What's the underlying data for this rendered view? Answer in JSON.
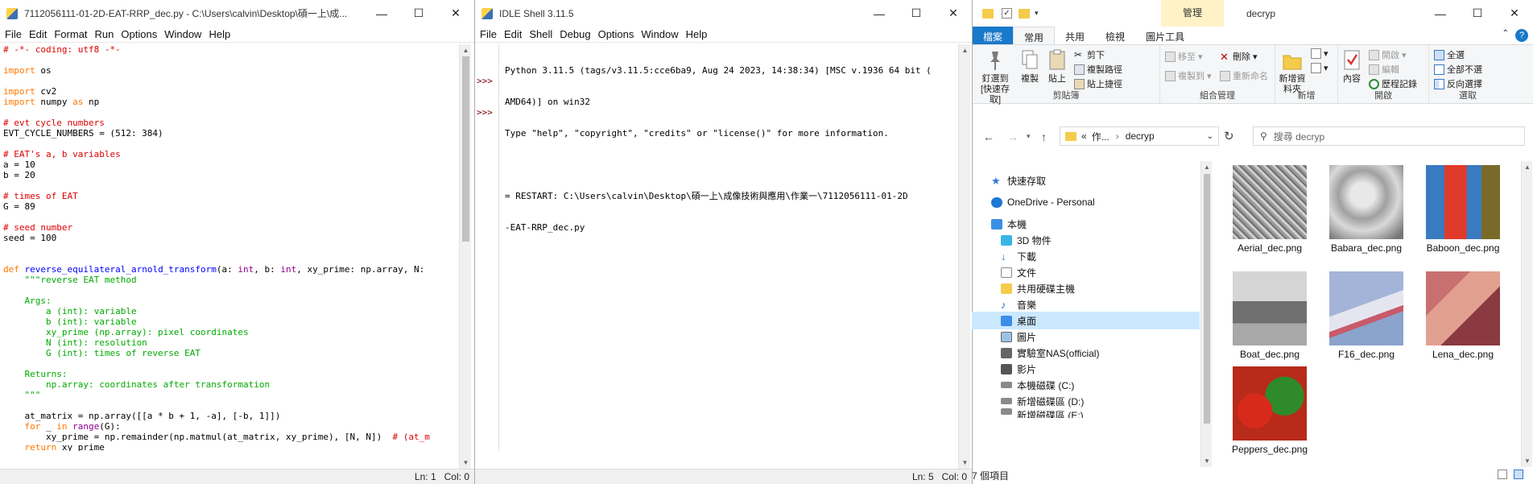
{
  "editor": {
    "title": "7112056111-01-2D-EAT-RRP_dec.py - C:\\Users\\calvin\\Desktop\\碩一上\\成...",
    "menus": [
      "File",
      "Edit",
      "Format",
      "Run",
      "Options",
      "Window",
      "Help"
    ],
    "status_ln": "Ln: 1",
    "status_col": "Col: 0"
  },
  "shell": {
    "title": "IDLE Shell 3.11.5",
    "menus": [
      "File",
      "Edit",
      "Shell",
      "Debug",
      "Options",
      "Window",
      "Help"
    ],
    "prompt": ">>>",
    "lines": [
      "Python 3.11.5 (tags/v3.11.5:cce6ba9, Aug 24 2023, 14:38:34) [MSC v.1936 64 bit (",
      "AMD64)] on win32",
      "Type \"help\", \"copyright\", \"credits\" or \"license()\" for more information.",
      "",
      "= RESTART: C:\\Users\\calvin\\Desktop\\碩一上\\成像技術與應用\\作業一\\7112056111-01-2D",
      "-EAT-RRP_dec.py"
    ],
    "status_ln": "Ln: 5",
    "status_col": "Col: 0"
  },
  "explorer": {
    "title": "decryp",
    "tool_tab": "管理",
    "tabs": [
      "檔案",
      "常用",
      "共用",
      "檢視",
      "圖片工具"
    ],
    "ribbon": {
      "pin": "釘選到 [快速存取]",
      "copy": "複製",
      "paste": "貼上",
      "cut": "剪下",
      "copy_path": "複製路徑",
      "paste_shortcut": "貼上捷徑",
      "move_to": "移至",
      "copy_to": "複製到",
      "delete": "刪除",
      "rename": "重新命名",
      "new_folder": "新增資料夾",
      "properties": "內容",
      "open": "開啟",
      "edit": "編輯",
      "history": "歷程記錄",
      "select_all": "全選",
      "select_none": "全部不選",
      "invert": "反向選擇",
      "groups": [
        "剪貼簿",
        "組合管理",
        "新增",
        "開啟",
        "選取"
      ]
    },
    "address_prefix": "«",
    "address_crumb1": "作...",
    "address_crumb2": "decryp",
    "search_placeholder": "搜尋 decryp",
    "nav": [
      "快速存取",
      "OneDrive - Personal",
      "本機",
      "3D 物件",
      "下載",
      "文件",
      "共用硬碟主機",
      "音樂",
      "桌面",
      "圖片",
      "實驗室NAS(official)",
      "影片",
      "本機磁碟 (C:)",
      "新增磁碟區 (D:)",
      "新增磁碟區 (E:)"
    ],
    "files": [
      "Aerial_dec.png",
      "Babara_dec.png",
      "Baboon_dec.png",
      "Boat_dec.png",
      "F16_dec.png",
      "Lena_dec.png",
      "Peppers_dec.png"
    ],
    "item_count": "7 個項目"
  }
}
